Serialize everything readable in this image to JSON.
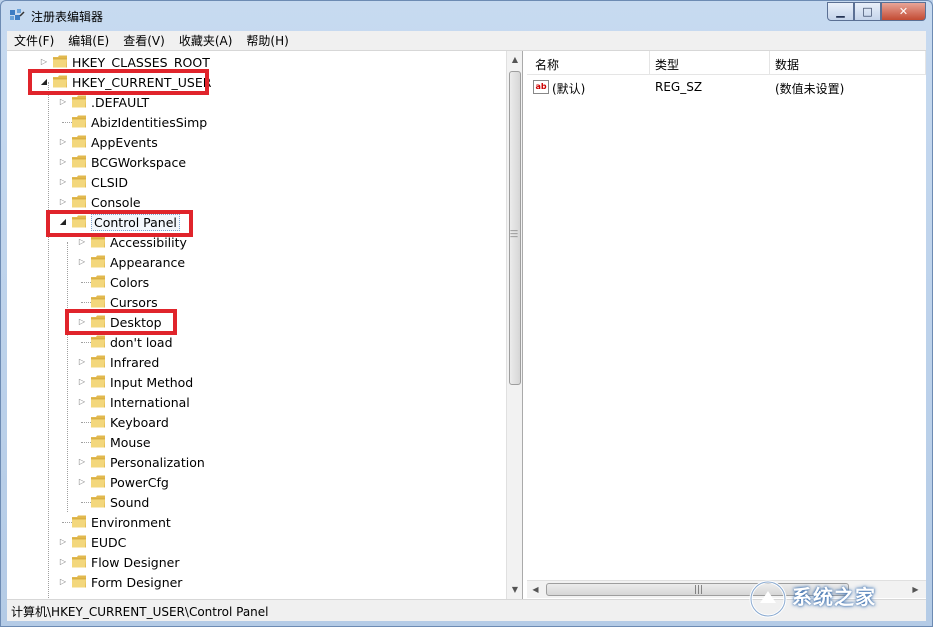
{
  "window": {
    "title": "注册表编辑器",
    "controls": {
      "minimize": "▭",
      "maximize": "□",
      "close": "✕"
    }
  },
  "menu": [
    "文件(F)",
    "编辑(E)",
    "查看(V)",
    "收藏夹(A)",
    "帮助(H)"
  ],
  "tree": {
    "hkcr": "HKEY_CLASSES_ROOT",
    "hkcu": "HKEY_CURRENT_USER",
    "hkcu_children": [
      ".DEFAULT",
      "AbizIdentitiesSimp",
      "AppEvents",
      "BCGWorkspace",
      "CLSID",
      "Console"
    ],
    "control_panel": "Control Panel",
    "control_panel_children": [
      "Accessibility",
      "Appearance",
      "Colors",
      "Cursors",
      "Desktop",
      "don't load",
      "Infrared",
      "Input Method",
      "International",
      "Keyboard",
      "Mouse",
      "Personalization",
      "PowerCfg",
      "Sound"
    ],
    "after_children": [
      "Environment",
      "EUDC",
      "Flow Designer",
      "Form Designer"
    ]
  },
  "list": {
    "columns": {
      "name": "名称",
      "type": "类型",
      "data": "数据"
    },
    "rows": [
      {
        "name": "(默认)",
        "type": "REG_SZ",
        "data": "(数值未设置)",
        "icon": "string-value-icon"
      }
    ]
  },
  "status": {
    "path": "计算机\\HKEY_CURRENT_USER\\Control Panel"
  },
  "watermark": {
    "brand": "系统之家"
  },
  "colors": {
    "highlight": "#e0242b",
    "folder": "#e8c96a"
  }
}
